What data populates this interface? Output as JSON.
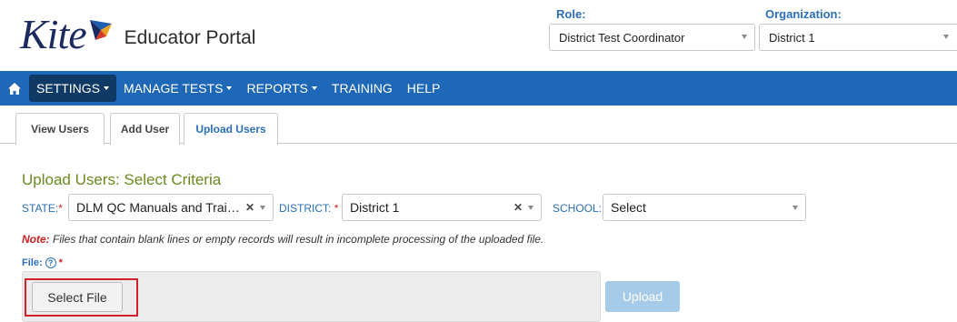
{
  "header": {
    "logo_word": "Kite",
    "portal_name": "Educator Portal",
    "role": {
      "label": "Role:",
      "value": "District Test Coordinator"
    },
    "organization": {
      "label": "Organization:",
      "value": "District 1"
    }
  },
  "nav": {
    "home_icon": "home-icon",
    "items": [
      {
        "label": "SETTINGS",
        "has_dropdown": true,
        "active": true
      },
      {
        "label": "MANAGE TESTS",
        "has_dropdown": true
      },
      {
        "label": "REPORTS",
        "has_dropdown": true
      },
      {
        "label": "TRAINING",
        "has_dropdown": false
      },
      {
        "label": "HELP",
        "has_dropdown": false
      }
    ]
  },
  "tabs": [
    {
      "label": "View Users"
    },
    {
      "label": "Add User"
    },
    {
      "label": "Upload Users",
      "active": true
    }
  ],
  "main": {
    "title": "Upload Users: Select Criteria",
    "state": {
      "label": "STATE:",
      "required": "*",
      "value": "DLM QC Manuals and Trai…"
    },
    "district": {
      "label": "DISTRICT:",
      "required": "*",
      "value": "District 1"
    },
    "school": {
      "label": "SCHOOL:",
      "value": "Select"
    },
    "note": {
      "prefix": "Note:",
      "text": " Files that contain blank lines or empty records will result in incomplete processing of the uploaded file."
    },
    "file": {
      "label": "File:",
      "required": "*",
      "help_icon": "question-circle-icon"
    },
    "select_file_label": "Select File",
    "upload_label": "Upload"
  },
  "colors": {
    "nav_bg": "#1f68b8",
    "nav_active": "#0f3a66",
    "title_green": "#6a8a1e",
    "label_blue": "#2a6fb8",
    "required_red": "#d02020",
    "highlight_red": "#d0202e",
    "upload_disabled": "#a6cbe8"
  }
}
